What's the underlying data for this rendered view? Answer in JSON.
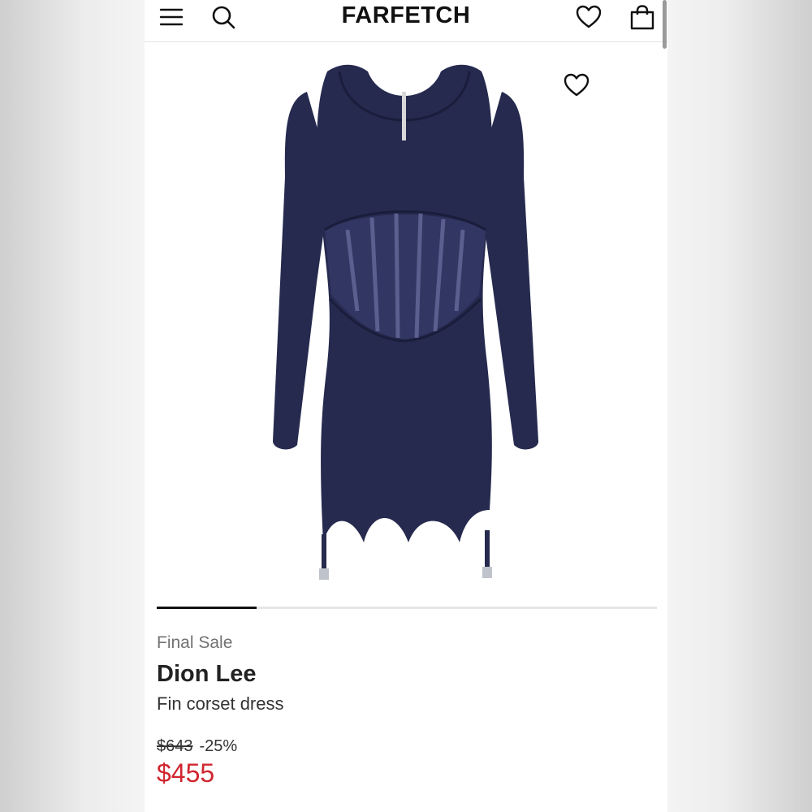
{
  "app": {
    "brand_logo": "FARFETCH",
    "accent_color": "#d0262f"
  },
  "header": {
    "menu_icon": "hamburger-menu-icon",
    "search_icon": "search-icon",
    "wishlist_icon": "heart-icon",
    "bag_icon": "shopping-bag-icon"
  },
  "product": {
    "image_alt": "Fin corset dress",
    "carousel_progress": 0.2,
    "label": "Final Sale",
    "brand": "Dion Lee",
    "name": "Fin corset dress",
    "original_price": "$643",
    "discount": "-25%",
    "sale_price": "$455",
    "dress_color": "#262a4f"
  }
}
